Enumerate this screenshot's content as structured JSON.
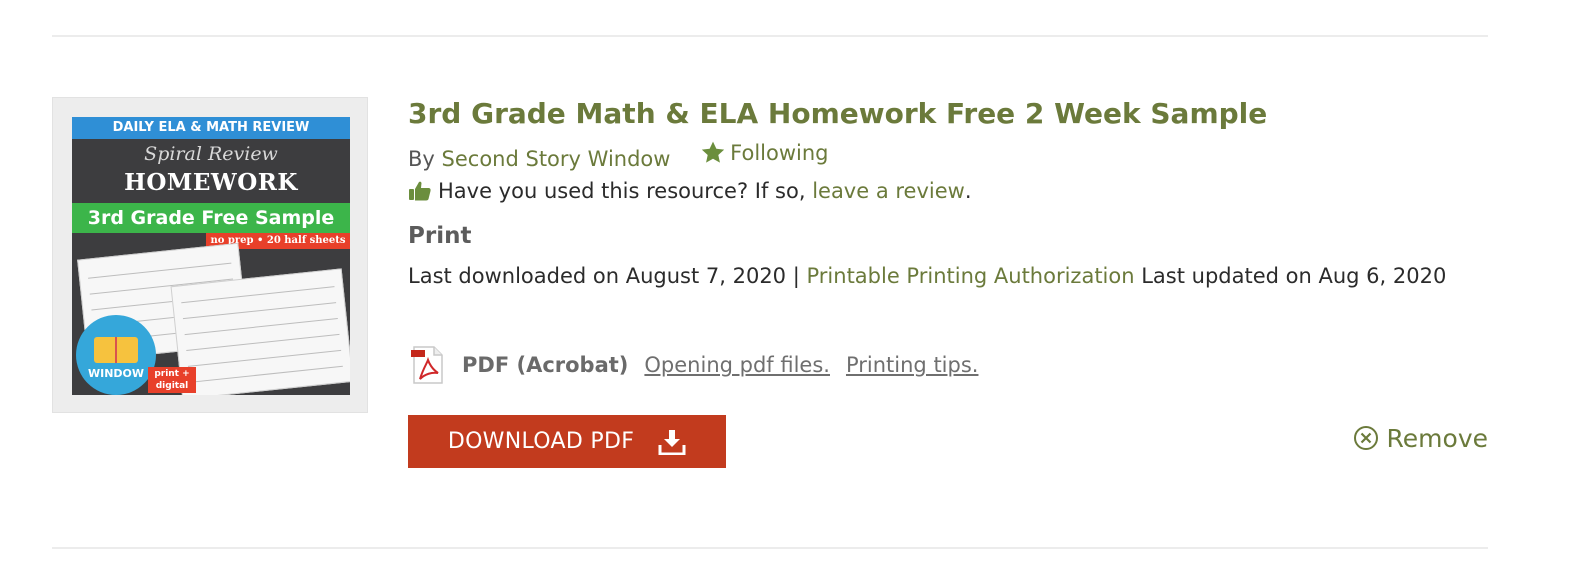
{
  "resource": {
    "title": "3rd Grade Math & ELA Homework Free 2 Week Sample",
    "by_label": "By",
    "author": "Second Story Window",
    "follow_label": "Following",
    "review_prompt": "Have you used this resource? If so,",
    "review_link": "leave a review",
    "review_suffix": "."
  },
  "thumbnail": {
    "top_band": "DAILY ELA & MATH REVIEW",
    "script_text": "Spiral Review",
    "heading": "HOMEWORK",
    "green_band": "3rd Grade Free Sample",
    "red_band": "no prep • 20 half sheets",
    "badge_text": "WINDOW",
    "tag_line1": "print +",
    "tag_line2": "digital"
  },
  "print_section": {
    "heading": "Print",
    "last_downloaded": "Last downloaded on August 7, 2020",
    "separator": "|",
    "authorization_link": "Printable Printing Authorization",
    "last_updated": "Last updated on Aug 6, 2020"
  },
  "file": {
    "type_label": "PDF (Acrobat)",
    "icon": "pdf-file-icon",
    "open_link": "Opening pdf files.",
    "tips_link": "Printing tips."
  },
  "actions": {
    "download_label": "DOWNLOAD PDF",
    "remove_label": "Remove"
  },
  "colors": {
    "accent_green": "#6b7a3b",
    "button_red": "#c23b1e",
    "star_green": "#6b8e3d"
  }
}
